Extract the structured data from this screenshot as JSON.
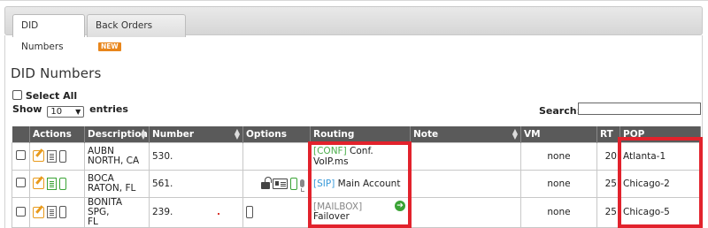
{
  "tabs": [
    {
      "label": "DID Numbers",
      "active": true
    },
    {
      "label": "Back Orders",
      "badge": "NEW",
      "active": false
    }
  ],
  "page_title": "DID Numbers",
  "select_all_label": "Select All",
  "show_prefix": "Show",
  "page_size": "10",
  "show_suffix": "entries",
  "search_label": "Search:",
  "search_value": "",
  "columns": [
    "Actions",
    "Description",
    "Number",
    "Options",
    "Routing",
    "Note",
    "VM",
    "RT",
    "POP"
  ],
  "rows": [
    {
      "description": [
        "AUBN",
        "NORTH, CA"
      ],
      "number": "530.",
      "routing_tag": "[CONF]",
      "routing_text": "Conf. VoIP.ms",
      "note": "",
      "vm": "none",
      "rt": "20",
      "pop": "Atlanta-1"
    },
    {
      "description": [
        "BOCA",
        "RATON, FL"
      ],
      "number": "561.",
      "routing_tag": "[SIP]",
      "routing_text": "Main Account",
      "note": "",
      "vm": "none",
      "rt": "25",
      "pop": "Chicago-2"
    },
    {
      "description": [
        "BONITA SPG,",
        "FL"
      ],
      "number": "239.",
      "routing_tag": "[MAILBOX]",
      "routing_text": "Failover",
      "note": "",
      "vm": "none",
      "rt": "25",
      "pop": "Chicago-5"
    }
  ],
  "colors": {
    "header_bg": "#5a5a5a",
    "highlight": "#e2222c",
    "badge": "#e8861c",
    "sip_tag": "#3a9ad9",
    "conf_tag": "#4cae4c"
  }
}
